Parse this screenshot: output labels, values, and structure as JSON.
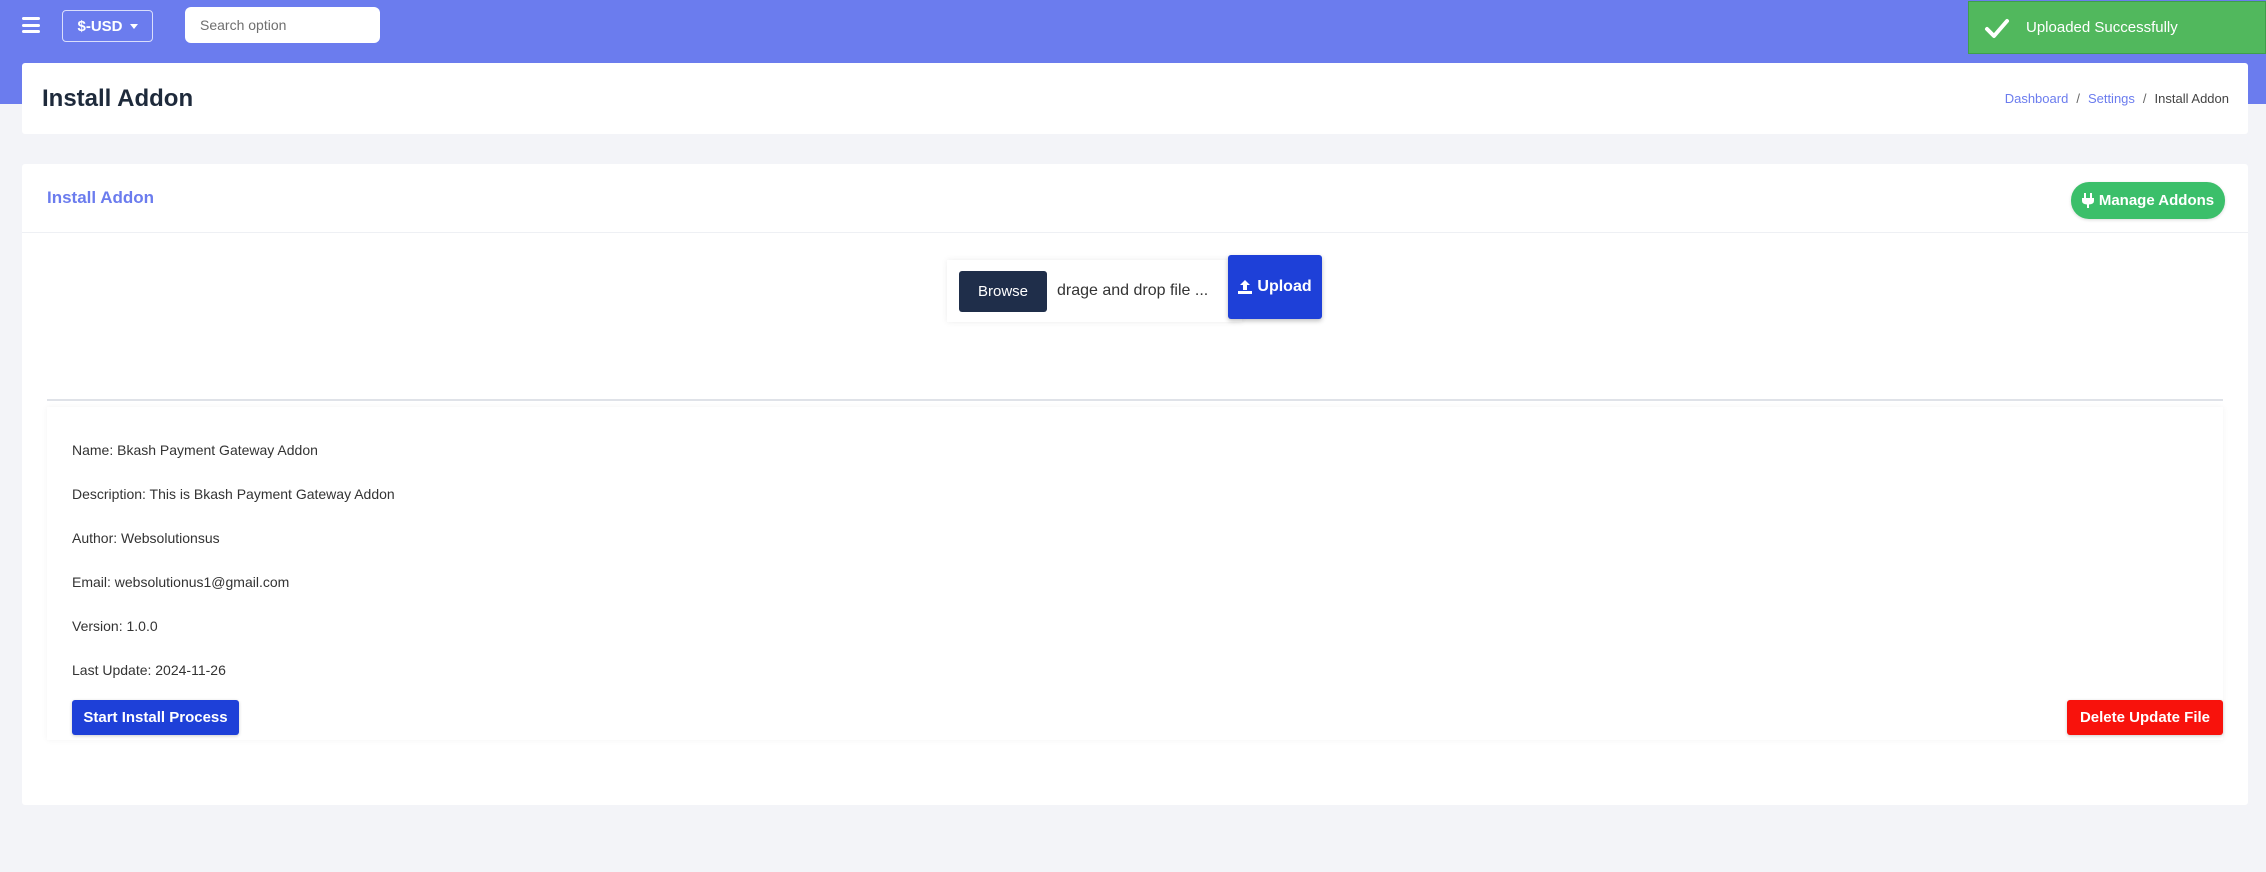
{
  "topbar": {
    "currency": "$-USD",
    "search_placeholder": "Search option"
  },
  "toast": {
    "message": "Uploaded Successfully"
  },
  "header": {
    "title": "Install Addon",
    "breadcrumb": [
      "Dashboard",
      "Settings",
      "Install Addon"
    ]
  },
  "card": {
    "title": "Install Addon",
    "manage_label": "Manage Addons",
    "browse_label": "Browse",
    "file_placeholder": "drage and drop file ...",
    "upload_label": "Upload"
  },
  "addon": {
    "name": "Name: Bkash Payment Gateway Addon",
    "description": "Description: This is Bkash Payment Gateway Addon",
    "author": "Author: Websolutionsus",
    "email": "Email: websolutionus1@gmail.com",
    "version": "Version: 1.0.0",
    "last_update": "Last Update: 2024-11-26"
  },
  "actions": {
    "install_label": "Start Install Process",
    "delete_label": "Delete Update File"
  },
  "colors": {
    "topbar": "#6b7cee",
    "primary": "#1e40d8",
    "success": "#3bbf6a",
    "danger": "#f8120c",
    "dark": "#1f2e4a"
  },
  "icons": {
    "menu": "hamburger-icon",
    "toast": "check-icon",
    "manage": "plug-icon",
    "upload": "upload-icon"
  }
}
